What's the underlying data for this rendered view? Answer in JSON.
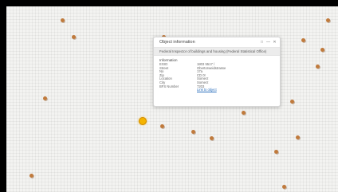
{
  "dialog": {
    "title": "Object information",
    "agency": "Federal Inspector of buildings and housing (Federal Statistical Office)",
    "section_title": "Information",
    "rows": [
      {
        "key": "EGID",
        "value": "1803 5517 /"
      },
      {
        "key": "Street",
        "value": "Obertorweidstrasse"
      },
      {
        "key": "No",
        "value": "17a"
      },
      {
        "key": "Zip",
        "value": "CD 0!"
      },
      {
        "key": "Location",
        "value": "Somerz"
      },
      {
        "key": "City",
        "value": "Somerz"
      },
      {
        "key": "BFS Number",
        "value": "7203"
      }
    ],
    "link_label": "Link to object",
    "controls": {
      "restore": "□",
      "minimize": "—",
      "close": "✕"
    }
  },
  "map": {
    "marker_count": 24,
    "selected_marker_color": "#f5b400",
    "marker_color": "#c07a3c"
  }
}
